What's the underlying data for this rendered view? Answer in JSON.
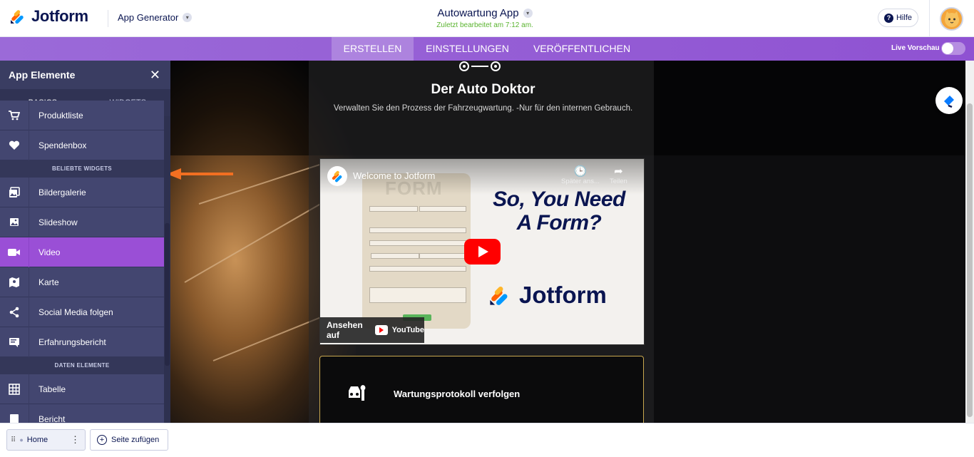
{
  "header": {
    "logo_text": "Jotform",
    "app_generator_label": "App Generator",
    "app_title": "Autowartung App",
    "last_edited": "Zuletzt bearbeitet am 7:12 am.",
    "help_label": "Hilfe"
  },
  "nav": {
    "tabs": [
      {
        "label": "ERSTELLEN",
        "active": true
      },
      {
        "label": "EINSTELLUNGEN",
        "active": false
      },
      {
        "label": "VERÖFFENTLICHEN",
        "active": false
      }
    ],
    "live_preview_label": "Live Vorschau",
    "live_preview_on": false
  },
  "sidebar": {
    "title": "App Elemente",
    "tabs": [
      "BASICS",
      "WIDGETS"
    ],
    "active_tab": "BASICS",
    "items_top": [
      {
        "label": "Produktliste",
        "icon": "cart-icon"
      },
      {
        "label": "Spendenbox",
        "icon": "heart-icon"
      }
    ],
    "section_popular": "BELIEBTE WIDGETS",
    "items_popular": [
      {
        "label": "Bildergalerie",
        "icon": "gallery-icon"
      },
      {
        "label": "Slideshow",
        "icon": "slideshow-icon"
      },
      {
        "label": "Video",
        "icon": "video-icon",
        "active": true
      },
      {
        "label": "Karte",
        "icon": "map-icon"
      },
      {
        "label": "Social Media folgen",
        "icon": "share-icon"
      },
      {
        "label": "Erfahrungsbericht",
        "icon": "testimonial-icon"
      }
    ],
    "section_data": "DATEN ELEMENTE",
    "items_data": [
      {
        "label": "Tabelle",
        "icon": "table-icon"
      },
      {
        "label": "Bericht",
        "icon": "report-icon"
      }
    ]
  },
  "canvas": {
    "app_name": "Der Auto Doktor",
    "app_description": "Verwalten Sie den Prozess der Fahrzeugwartung. -Nur für den internen Gebrauch.",
    "video": {
      "title": "Welcome to Jotform",
      "watch_later": "Später ans...",
      "share": "Teilen",
      "form_word": "FORM",
      "headline_1": "So, You Need",
      "headline_2": "A Form?",
      "brand": "Jotform",
      "watch_on": "Ansehen auf",
      "youtube": "YouTube"
    },
    "card_label": "Wartungsprotokoll verfolgen"
  },
  "bottom": {
    "page_label": "Home",
    "add_page_label": "Seite zufügen"
  },
  "colors": {
    "purple": "#9b6ad8",
    "sidebar": "#434670",
    "active_item": "#9a4fd6",
    "navy": "#0a1551",
    "arrow": "#f26f21"
  }
}
